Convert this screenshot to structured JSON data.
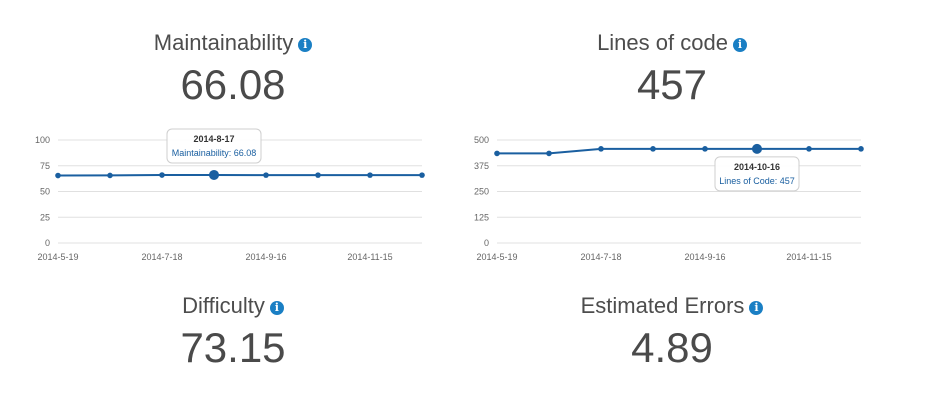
{
  "panels": {
    "maintainability": {
      "title": "Maintainability",
      "value": "66.08"
    },
    "lines_of_code": {
      "title": "Lines of code",
      "value": "457"
    },
    "difficulty": {
      "title": "Difficulty",
      "value": "73.15"
    },
    "estimated_errors": {
      "title": "Estimated Errors",
      "value": "4.89"
    }
  },
  "icons": {
    "info": "info-icon",
    "info_glyph": "i"
  },
  "colors": {
    "line": "#1a5fa0",
    "grid": "#e0e0e0",
    "info": "#1a7fc4",
    "tick": "#666666"
  },
  "chart_data": [
    {
      "type": "line",
      "title": "",
      "xlabel": "",
      "ylabel": "",
      "x_tick_labels": [
        "2014-5-19",
        "2014-7-18",
        "2014-9-16",
        "2014-11-15"
      ],
      "y_ticks": [
        0,
        25,
        50,
        75,
        100
      ],
      "ylim": [
        0,
        100
      ],
      "grid": true,
      "series": [
        {
          "x": [
            "2014-5-19",
            "2014-6-18",
            "2014-7-18",
            "2014-8-17",
            "2014-9-16",
            "2014-10-16",
            "2014-11-15",
            "2014-12-15"
          ],
          "values": [
            65.5,
            65.6,
            66.0,
            66.08,
            65.9,
            65.9,
            65.9,
            65.9
          ]
        }
      ],
      "tooltip": {
        "date": "2014-8-17",
        "text": "Maintainability: 66.08"
      }
    },
    {
      "type": "line",
      "title": "",
      "xlabel": "",
      "ylabel": "",
      "x_tick_labels": [
        "2014-5-19",
        "2014-7-18",
        "2014-9-16",
        "2014-11-15"
      ],
      "y_ticks": [
        0,
        125,
        250,
        375,
        500
      ],
      "ylim": [
        0,
        500
      ],
      "grid": true,
      "series": [
        {
          "x": [
            "2014-5-19",
            "2014-6-18",
            "2014-7-18",
            "2014-8-17",
            "2014-9-16",
            "2014-10-16",
            "2014-11-15",
            "2014-12-15"
          ],
          "values": [
            435,
            435,
            457,
            457,
            457,
            457,
            457,
            457
          ]
        }
      ],
      "tooltip": {
        "date": "2014-10-16",
        "text": "Lines of Code: 457"
      }
    }
  ]
}
